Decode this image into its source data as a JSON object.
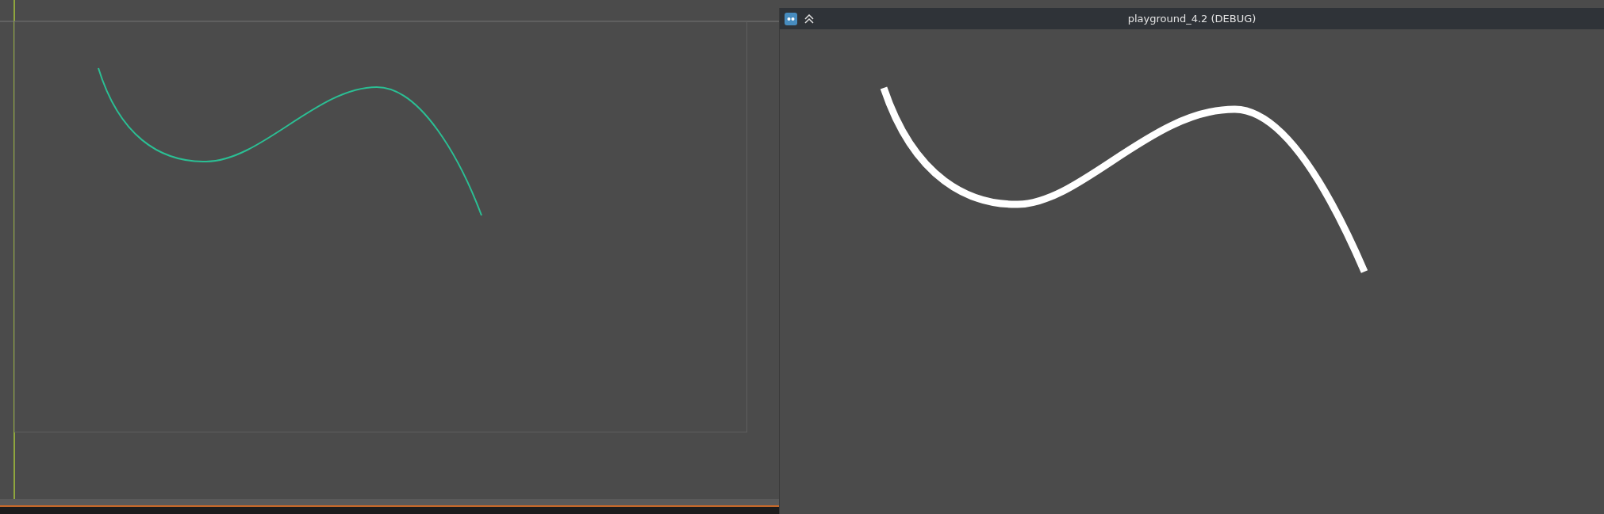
{
  "game_window": {
    "title": "playground_4.2 (DEBUG)"
  }
}
